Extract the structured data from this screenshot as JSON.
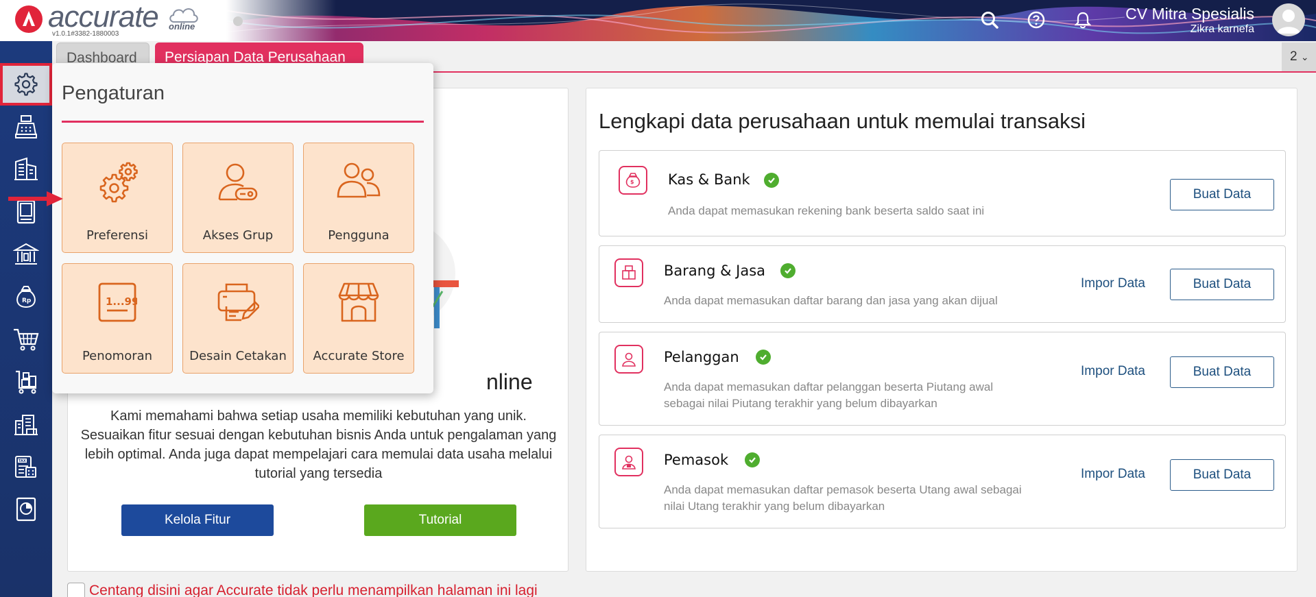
{
  "header": {
    "logo_text": "accurate",
    "logo_sub": "online",
    "version": "v1.0.1#3382-1880003",
    "company_name": "CV Mitra Spesialis",
    "user_name": "Zikra karnefa"
  },
  "tabs": [
    {
      "label": "Dashboard"
    },
    {
      "label": "Persiapan Data Perusahaan"
    }
  ],
  "tab_count": "2",
  "sidebar_icons": [
    "gear-icon",
    "cashier-icon",
    "building-icon",
    "book-icon",
    "bank-icon",
    "money-bag-icon",
    "cart-icon",
    "trolley-icon",
    "warehouse-icon",
    "tax-icon",
    "report-icon"
  ],
  "popup": {
    "title": "Pengaturan",
    "tiles": [
      {
        "label": "Preferensi",
        "icon": "gears-icon"
      },
      {
        "label": "Akses Grup",
        "icon": "user-key-icon"
      },
      {
        "label": "Pengguna",
        "icon": "users-icon"
      },
      {
        "label": "Penomoran",
        "icon": "numbering-icon",
        "icon_text": "1...99"
      },
      {
        "label": "Desain Cetakan",
        "icon": "printer-design-icon"
      },
      {
        "label": "Accurate Store",
        "icon": "store-icon"
      }
    ]
  },
  "left": {
    "title_partial": "nline",
    "description": "Kami memahami bahwa setiap usaha memiliki kebutuhan yang unik. Sesuaikan fitur sesuai dengan kebutuhan bisnis Anda untuk pengalaman yang lebih optimal. Anda juga dapat mempelajari cara memulai data usaha melalui tutorial yang tersedia",
    "btn_kelola": "Kelola Fitur",
    "btn_tutorial": "Tutorial"
  },
  "right": {
    "title": "Lengkapi data perusahaan untuk memulai transaksi",
    "items": [
      {
        "title": "Kas & Bank",
        "desc1": "Anda dapat memasukan rekening bank beserta saldo saat ini",
        "desc2": "",
        "impor": "",
        "buat": "Buat Data"
      },
      {
        "title": "Barang & Jasa",
        "desc1": "Anda dapat memasukan daftar barang dan jasa yang akan dijual",
        "desc2": "",
        "impor": "Impor Data",
        "buat": "Buat Data"
      },
      {
        "title": "Pelanggan",
        "desc1": "Anda dapat memasukan daftar pelanggan beserta Piutang awal",
        "desc2": "sebagai nilai Piutang terakhir yang belum dibayarkan",
        "impor": "Impor Data",
        "buat": "Buat Data"
      },
      {
        "title": "Pemasok",
        "desc1": "Anda dapat memasukan daftar pemasok beserta Utang awal sebagai",
        "desc2": "nilai Utang terakhir yang belum dibayarkan",
        "impor": "Impor Data",
        "buat": "Buat Data"
      }
    ]
  },
  "bottom": {
    "checkbox_label": "Centang disini agar Accurate tidak perlu menampilkan halaman ini lagi"
  }
}
